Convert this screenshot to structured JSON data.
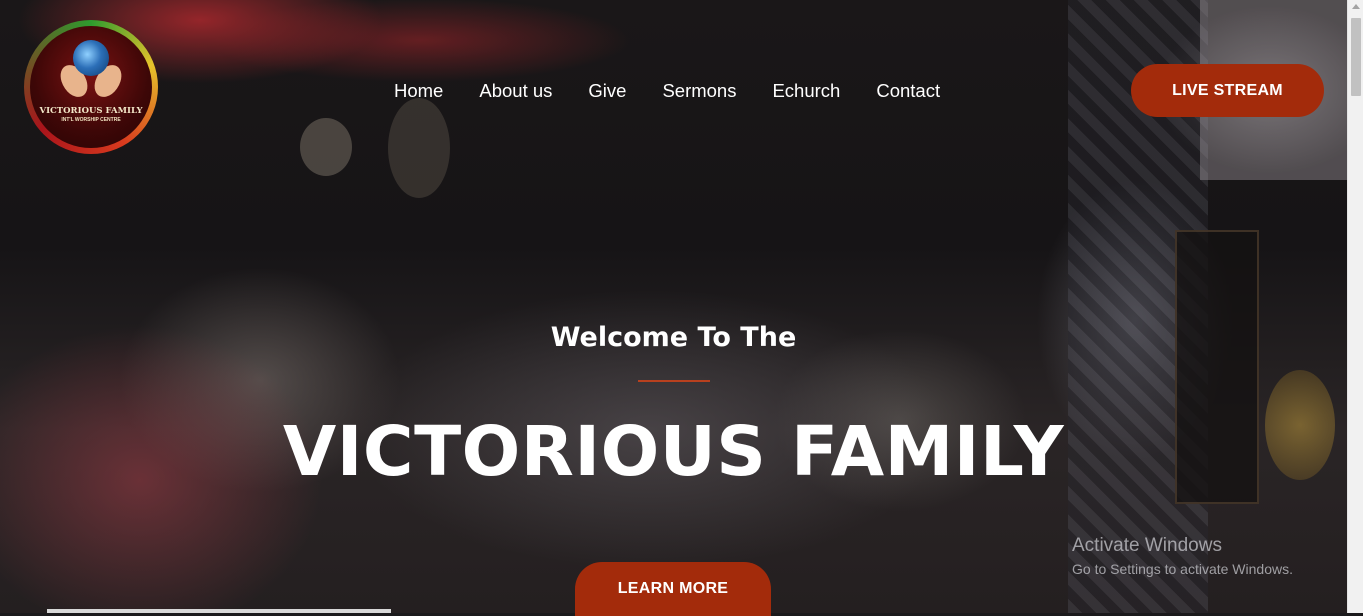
{
  "logo": {
    "name": "VICTORIOUS FAMILY",
    "subtitle": "INT'L WORSHIP CENTRE",
    "alt": "Victorious Family Int'l Worship Centre logo"
  },
  "nav": {
    "items": [
      "Home",
      "About us",
      "Give",
      "Sermons",
      "Echurch",
      "Contact"
    ]
  },
  "live_stream_label": "LIVE STREAM",
  "hero": {
    "welcome": "Welcome To The",
    "title": "VICTORIOUS FAMILY",
    "learn_more_label": "LEARN MORE"
  },
  "watermark": {
    "title": "Activate Windows",
    "subtitle": "Go to Settings to activate Windows."
  },
  "colors": {
    "accent": "#a32b0b",
    "divider": "#b8401e",
    "text": "#ffffff"
  }
}
